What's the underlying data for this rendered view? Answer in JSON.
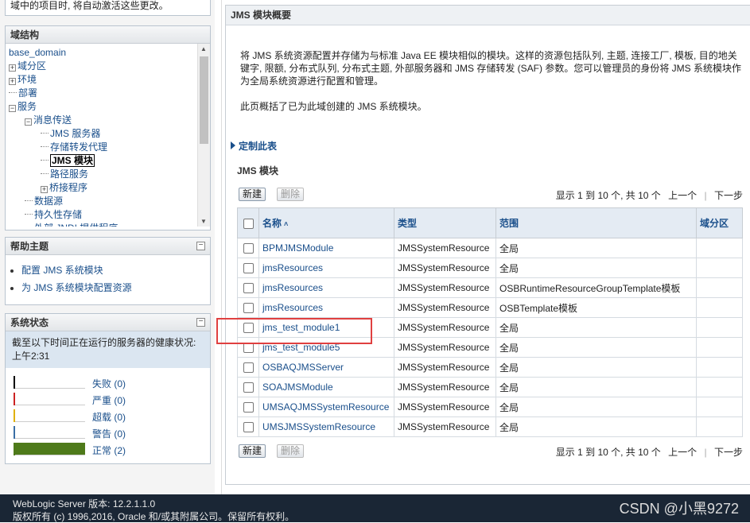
{
  "top_note": "域中的项目时, 将自动激活这些更改。",
  "domain_structure": {
    "title": "域结构",
    "items": [
      {
        "label": "base_domain",
        "level": 0,
        "exp": ""
      },
      {
        "label": "域分区",
        "level": 0,
        "exp": "+"
      },
      {
        "label": "环境",
        "level": 0,
        "exp": "+"
      },
      {
        "label": "部署",
        "level": 0,
        "exp": "-"
      },
      {
        "label": "服务",
        "level": 0,
        "exp": "−"
      },
      {
        "label": "消息传送",
        "level": 1,
        "exp": "−"
      },
      {
        "label": "JMS 服务器",
        "level": 2,
        "exp": "-"
      },
      {
        "label": "存储转发代理",
        "level": 2,
        "exp": "-"
      },
      {
        "label": "JMS 模块",
        "level": 2,
        "exp": "-",
        "selected": true
      },
      {
        "label": "路径服务",
        "level": 2,
        "exp": "-"
      },
      {
        "label": "桥接程序",
        "level": 2,
        "exp": "+"
      },
      {
        "label": "数据源",
        "level": 1,
        "exp": "-"
      },
      {
        "label": "持久性存储",
        "level": 1,
        "exp": "-"
      },
      {
        "label": "外部 JNDI 提供程序",
        "level": 1,
        "exp": "-"
      }
    ]
  },
  "help": {
    "title": "帮助主题",
    "items": [
      "配置 JMS 系统模块",
      "为 JMS 系统模块配置资源"
    ]
  },
  "system_status": {
    "title": "系统状态",
    "description": "截至以下时间正在运行的服务器的健康状况: 上午2:31",
    "rows": [
      {
        "label": "失败 (0)",
        "color": "#000000",
        "fill": 0
      },
      {
        "label": "严重 (0)",
        "color": "#cc2222",
        "fill": 0
      },
      {
        "label": "超载 (0)",
        "color": "#e0b000",
        "fill": 0
      },
      {
        "label": "警告 (0)",
        "color": "#3a6ea5",
        "fill": 0
      },
      {
        "label": "正常 (2)",
        "color": "#4e7a1a",
        "fill": 1
      }
    ]
  },
  "main": {
    "header": "JMS 模块概要",
    "description": "将 JMS 系统资源配置并存储为与标准 Java EE 模块相似的模块。这样的资源包括队列, 主题, 连接工厂, 模板, 目的地关键字, 限额, 分布式队列, 分布式主题, 外部服务器和 JMS 存储转发 (SAF) 参数。您可以管理员的身份将 JMS 系统模块作为全局系统资源进行配置和管理。",
    "description2": "此页概括了已为此域创建的 JMS 系统模块。",
    "customize": "定制此表",
    "section_title": "JMS 模块",
    "new_button": "新建",
    "delete_button": "删除",
    "pager_text": "显示 1 到 10 个, 共 10 个",
    "prev": "上一个",
    "next": "下一步",
    "columns": [
      "名称",
      "类型",
      "范围",
      "域分区"
    ],
    "rows": [
      {
        "name": "BPMJMSModule",
        "type": "JMSSystemResource",
        "scope": "全局",
        "partition": ""
      },
      {
        "name": "jmsResources",
        "type": "JMSSystemResource",
        "scope": "全局",
        "partition": ""
      },
      {
        "name": "jmsResources",
        "type": "JMSSystemResource",
        "scope": "OSBRuntimeResourceGroupTemplate模板",
        "partition": ""
      },
      {
        "name": "jmsResources",
        "type": "JMSSystemResource",
        "scope": "OSBTemplate模板",
        "partition": ""
      },
      {
        "name": "jms_test_module1",
        "type": "JMSSystemResource",
        "scope": "全局",
        "partition": ""
      },
      {
        "name": "jms_test_module5",
        "type": "JMSSystemResource",
        "scope": "全局",
        "partition": ""
      },
      {
        "name": "OSBAQJMSServer",
        "type": "JMSSystemResource",
        "scope": "全局",
        "partition": ""
      },
      {
        "name": "SOAJMSModule",
        "type": "JMSSystemResource",
        "scope": "全局",
        "partition": ""
      },
      {
        "name": "UMSAQJMSSystemResource",
        "type": "JMSSystemResource",
        "scope": "全局",
        "partition": ""
      },
      {
        "name": "UMSJMSSystemResource",
        "type": "JMSSystemResource",
        "scope": "全局",
        "partition": ""
      }
    ]
  },
  "footer": {
    "line1": "WebLogic Server 版本: 12.2.1.1.0",
    "line2": "版权所有 (c) 1996,2016, Oracle 和/或其附属公司。保留所有权利。",
    "watermark": "CSDN @小黑9272"
  }
}
